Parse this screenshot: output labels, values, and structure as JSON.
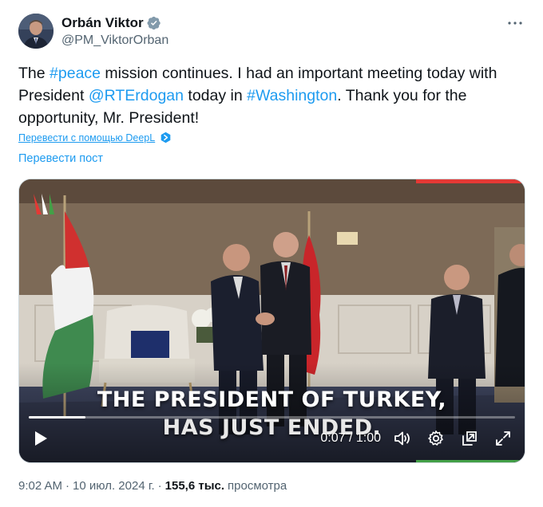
{
  "author": {
    "display_name": "Orbán Viktor",
    "handle": "@PM_ViktorOrban",
    "verified_icon": "verified-badge-icon",
    "badge_color": "#829aab"
  },
  "tweet": {
    "part1": "The ",
    "hashtag_peace": "#peace",
    "part2": " mission continues. I had an important meeting today with President ",
    "mention": "@RTErdogan",
    "part3": " today in ",
    "hashtag_washington": "#Washington",
    "part4": ". Thank you for the opportunity, Mr. President!"
  },
  "translate": {
    "deepl_label": "Перевести с помощью DeepL",
    "post_label": "Перевести пост"
  },
  "video": {
    "caption_line1": "THE PRESIDENT OF TURKEY,",
    "caption_line2": "HAS JUST ENDED.",
    "time": "0:07 / 1:00",
    "progress": 0.117,
    "icons": [
      "play-icon",
      "volume-icon",
      "settings-icon",
      "pip-icon",
      "fullscreen-icon"
    ]
  },
  "meta": {
    "time": "9:02 AM",
    "sep1": "·",
    "date": "10 июл. 2024 г.",
    "sep2": "·",
    "views_count": "155,6 тыс.",
    "views_label": "просмотра"
  },
  "colors": {
    "link": "#1d9bf0",
    "text": "#0f1419",
    "secondary": "#536471"
  }
}
